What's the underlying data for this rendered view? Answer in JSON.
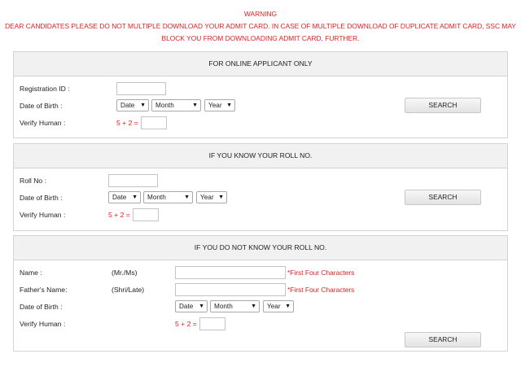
{
  "warning": {
    "title": "WARNING",
    "line1": "DEAR CANDIDATES PLEASE DO NOT MULTIPLE DOWNLOAD YOUR ADMIT CARD. IN CASE OF MULTIPLE DOWNLOAD OF DUPLICATE ADMIT CARD, SSC MAY",
    "line2": "BLOCK YOU FROM DOWNLOADING ADMIT CARD, FURTHER."
  },
  "online": {
    "heading": "FOR ONLINE APPLICANT ONLY",
    "registration_label": "Registration ID :",
    "dob_label": "Date of Birth :",
    "verify_label": "Verify Human :",
    "captcha": "5 + 2 =",
    "date_select": "Date",
    "month_select": "Month",
    "year_select": "Year",
    "search_label": "SEARCH"
  },
  "know_roll": {
    "heading": "IF YOU KNOW YOUR ROLL NO.",
    "roll_label": "Roll No :",
    "dob_label": "Date of Birth :",
    "verify_label": "Verify Human :",
    "captcha": "5 + 2 =",
    "date_select": "Date",
    "month_select": "Month",
    "year_select": "Year",
    "search_label": "SEARCH"
  },
  "unknown_roll": {
    "heading": "IF YOU DO NOT KNOW YOUR ROLL NO.",
    "name_label": "Name :",
    "name_prefix": "(Mr./Ms)",
    "name_hint": "*First Four Characters",
    "father_label": "Father's Name:",
    "father_prefix": "(Shri/Late)",
    "father_hint": "*First Four Characters",
    "dob_label": "Date of Birth :",
    "verify_label": "Verify Human :",
    "captcha": "5 + 2 =",
    "date_select": "Date",
    "month_select": "Month",
    "year_select": "Year",
    "search_label": "SEARCH"
  },
  "icons": {
    "dropdown": "chevron-down-icon",
    "dropdown_glyph": "▼"
  },
  "colors": {
    "warning_red": "#e02020",
    "panel_header_bg": "#f1f1f1"
  }
}
